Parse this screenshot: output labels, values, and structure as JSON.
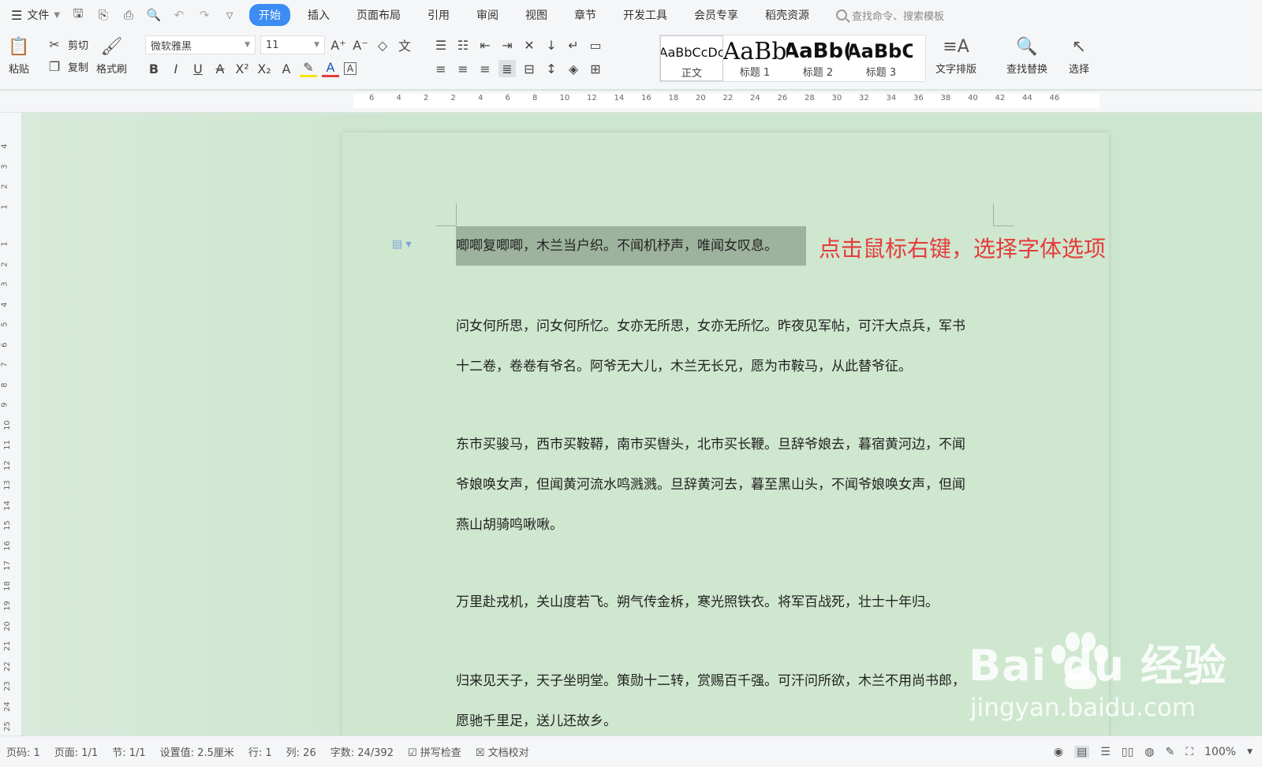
{
  "menu": {
    "file_label": "文件",
    "tabs": [
      "开始",
      "插入",
      "页面布局",
      "引用",
      "审阅",
      "视图",
      "章节",
      "开发工具",
      "会员专享",
      "稻壳资源"
    ],
    "active_tab": 0,
    "search_placeholder": "查找命令、搜索模板"
  },
  "ribbon": {
    "paste": "粘贴",
    "cut": "剪切",
    "copy": "复制",
    "format_painter": "格式刷",
    "font_name": "微软雅黑",
    "font_size": "11",
    "styles": [
      {
        "preview": "AaBbCcDc",
        "label": "正文"
      },
      {
        "preview": "AaBb",
        "label": "标题 1"
      },
      {
        "preview": "AaBb(",
        "label": "标题 2"
      },
      {
        "preview": "AaBbC",
        "label": "标题 3"
      }
    ],
    "text_layout": "文字排版",
    "find_replace": "查找替换",
    "select": "选择"
  },
  "ruler": {
    "h_ticks": [
      "6",
      "4",
      "2",
      "2",
      "4",
      "6",
      "8",
      "10",
      "12",
      "14",
      "16",
      "18",
      "20",
      "22",
      "24",
      "26",
      "28",
      "30",
      "32",
      "34",
      "36",
      "38",
      "40",
      "42",
      "44",
      "46"
    ],
    "v_ticks": [
      "4",
      "3",
      "2",
      "1",
      "1",
      "2",
      "3",
      "4",
      "5",
      "6",
      "7",
      "8",
      "9",
      "10",
      "11",
      "12",
      "13",
      "14",
      "15",
      "16",
      "17",
      "18",
      "19",
      "20",
      "21",
      "22",
      "23",
      "24",
      "25"
    ]
  },
  "document": {
    "selected_line": "唧唧复唧唧，木兰当户织。不闻机杼声，唯闻女叹息。",
    "annotation": "点击鼠标右键，选择字体选项",
    "paragraphs": [
      [
        "问女何所思，问女何所忆。女亦无所思，女亦无所忆。昨夜见军帖，可汗大点兵，军书",
        "十二卷，卷卷有爷名。阿爷无大儿，木兰无长兄，愿为市鞍马，从此替爷征。"
      ],
      [
        "东市买骏马，西市买鞍鞯，南市买辔头，北市买长鞭。旦辞爷娘去，暮宿黄河边，不闻",
        "爷娘唤女声，但闻黄河流水鸣溅溅。旦辞黄河去，暮至黑山头，不闻爷娘唤女声，但闻",
        "燕山胡骑鸣啾啾。"
      ],
      [
        "万里赴戎机，关山度若飞。朔气传金柝，寒光照铁衣。将军百战死，壮士十年归。"
      ],
      [
        "归来见天子，天子坐明堂。策勋十二转，赏赐百千强。可汗问所欲，木兰不用尚书郎，",
        "愿驰千里足，送儿还故乡。"
      ]
    ]
  },
  "watermark": {
    "brand": "Bai du 经验",
    "url": "jingyan.baidu.com"
  },
  "status": {
    "page_code": "页码: 1",
    "page": "页面: 1/1",
    "section": "节: 1/1",
    "setting": "设置值: 2.5厘米",
    "row": "行: 1",
    "col": "列: 26",
    "word_count": "字数: 24/392",
    "spell_check": "拼写检查",
    "doc_proof": "文档校对",
    "zoom": "100%"
  }
}
